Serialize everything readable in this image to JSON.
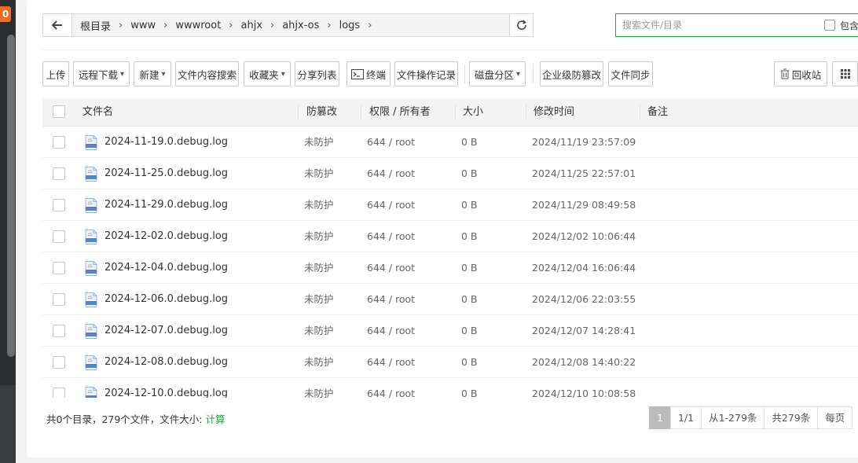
{
  "sidebar": {
    "badge": "0"
  },
  "path": {
    "crumbs": [
      "根目录",
      "www",
      "wwwroot",
      "ahjx",
      "ahjx-os",
      "logs"
    ]
  },
  "search": {
    "placeholder": "搜索文件/目录",
    "include_label": "包含"
  },
  "toolbar": {
    "upload": "上传",
    "remote_download": "远程下载",
    "new": "新建",
    "content_search": "文件内容搜索",
    "favorites": "收藏夹",
    "share_list": "分享列表",
    "terminal": "终端",
    "op_log": "文件操作记录",
    "disk": "磁盘分区",
    "tamper": "企业级防篡改",
    "sync": "文件同步",
    "recycle": "回收站"
  },
  "table": {
    "headers": {
      "name": "文件名",
      "protect": "防篡改",
      "perm": "权限 / 所有者",
      "size": "大小",
      "mtime": "修改时间",
      "note": "备注"
    },
    "rows": [
      {
        "name": "2024-11-19.0.debug.log",
        "protect": "未防护",
        "perm": "644 / root",
        "size": "0 B",
        "mtime": "2024/11/19 23:57:09"
      },
      {
        "name": "2024-11-25.0.debug.log",
        "protect": "未防护",
        "perm": "644 / root",
        "size": "0 B",
        "mtime": "2024/11/25 22:57:01"
      },
      {
        "name": "2024-11-29.0.debug.log",
        "protect": "未防护",
        "perm": "644 / root",
        "size": "0 B",
        "mtime": "2024/11/29 08:49:58"
      },
      {
        "name": "2024-12-02.0.debug.log",
        "protect": "未防护",
        "perm": "644 / root",
        "size": "0 B",
        "mtime": "2024/12/02 10:06:44"
      },
      {
        "name": "2024-12-04.0.debug.log",
        "protect": "未防护",
        "perm": "644 / root",
        "size": "0 B",
        "mtime": "2024/12/04 16:06:44"
      },
      {
        "name": "2024-12-06.0.debug.log",
        "protect": "未防护",
        "perm": "644 / root",
        "size": "0 B",
        "mtime": "2024/12/06 22:03:55"
      },
      {
        "name": "2024-12-07.0.debug.log",
        "protect": "未防护",
        "perm": "644 / root",
        "size": "0 B",
        "mtime": "2024/12/07 14:28:41"
      },
      {
        "name": "2024-12-08.0.debug.log",
        "protect": "未防护",
        "perm": "644 / root",
        "size": "0 B",
        "mtime": "2024/12/08 14:40:22"
      },
      {
        "name": "2024-12-10.0.debug.log",
        "protect": "未防护",
        "perm": "644 / root",
        "size": "0 B",
        "mtime": "2024/12/10 10:08:58"
      }
    ]
  },
  "footer": {
    "summary": "共0个目录，279个文件，文件大小: ",
    "calc": "计算",
    "pager": {
      "current": "1",
      "pages": "1/1",
      "range": "从1-279条",
      "total": "共279条",
      "per_page": "每页"
    }
  },
  "colors": {
    "accent": "#20a53a",
    "badge": "#f06a20"
  },
  "icons": [
    "back-arrow-icon",
    "refresh-icon",
    "chevron-down-icon",
    "terminal-icon",
    "trash-icon",
    "grid-icon",
    "log-file-icon"
  ]
}
